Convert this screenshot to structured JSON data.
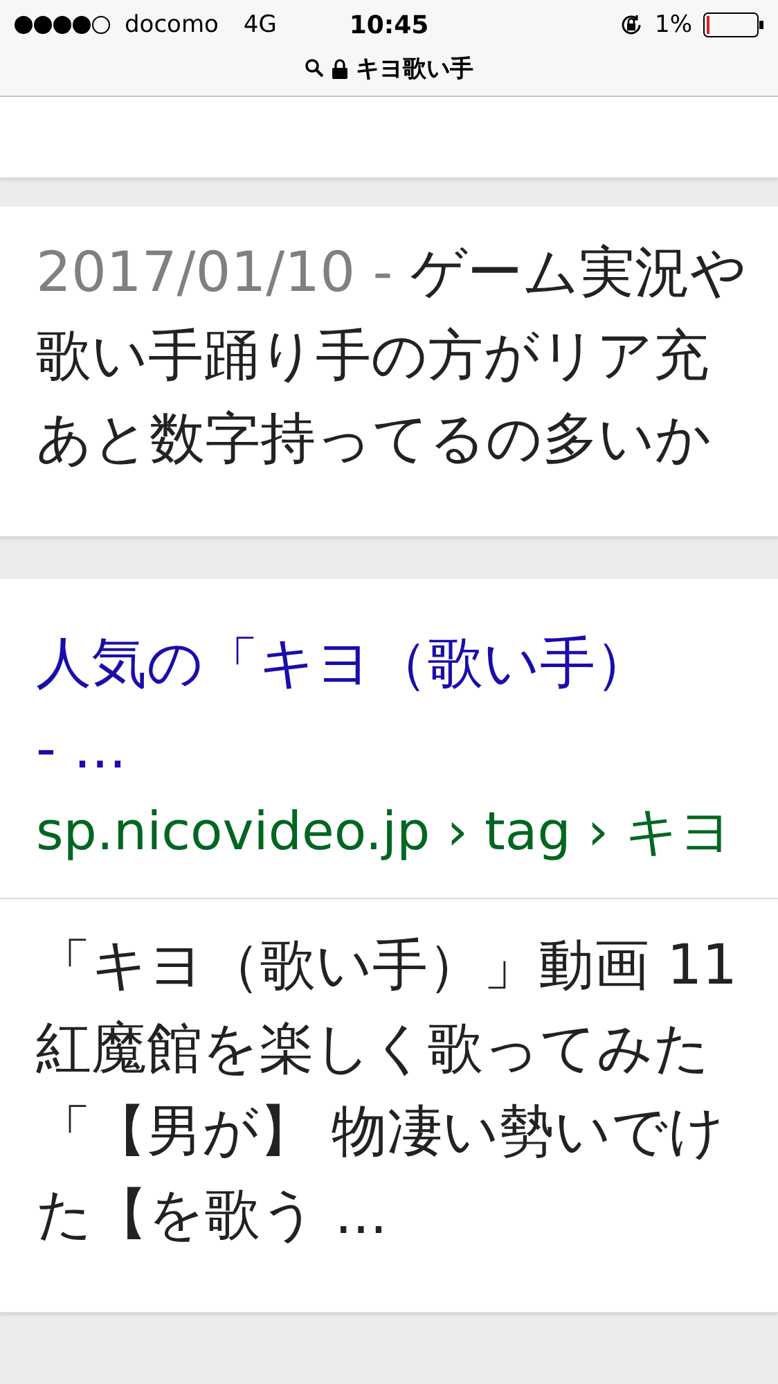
{
  "status_bar": {
    "carrier": "docomo",
    "network": "4G",
    "time": "10:45",
    "battery": "1%"
  },
  "address_bar": {
    "query": "キヨ歌い手"
  },
  "results": [
    {
      "kind": "snippet",
      "date": "2017/01/10",
      "separator": "-",
      "lines": [
        "ゲーム実況や",
        "歌い手踊り手の方がリア充",
        "あと数字持ってるの多いか"
      ]
    },
    {
      "kind": "title",
      "title_lines": [
        "人気の「キヨ（歌い手）",
        "- ..."
      ],
      "url": "sp.nicovideo.jp › tag › キヨ"
    },
    {
      "kind": "snippet",
      "lines": [
        "「キヨ（歌い手）」動画 11",
        "紅魔館を楽しく歌ってみた",
        "「【男が】 物凄い勢いでけ",
        "た【を歌う ..."
      ]
    }
  ]
}
